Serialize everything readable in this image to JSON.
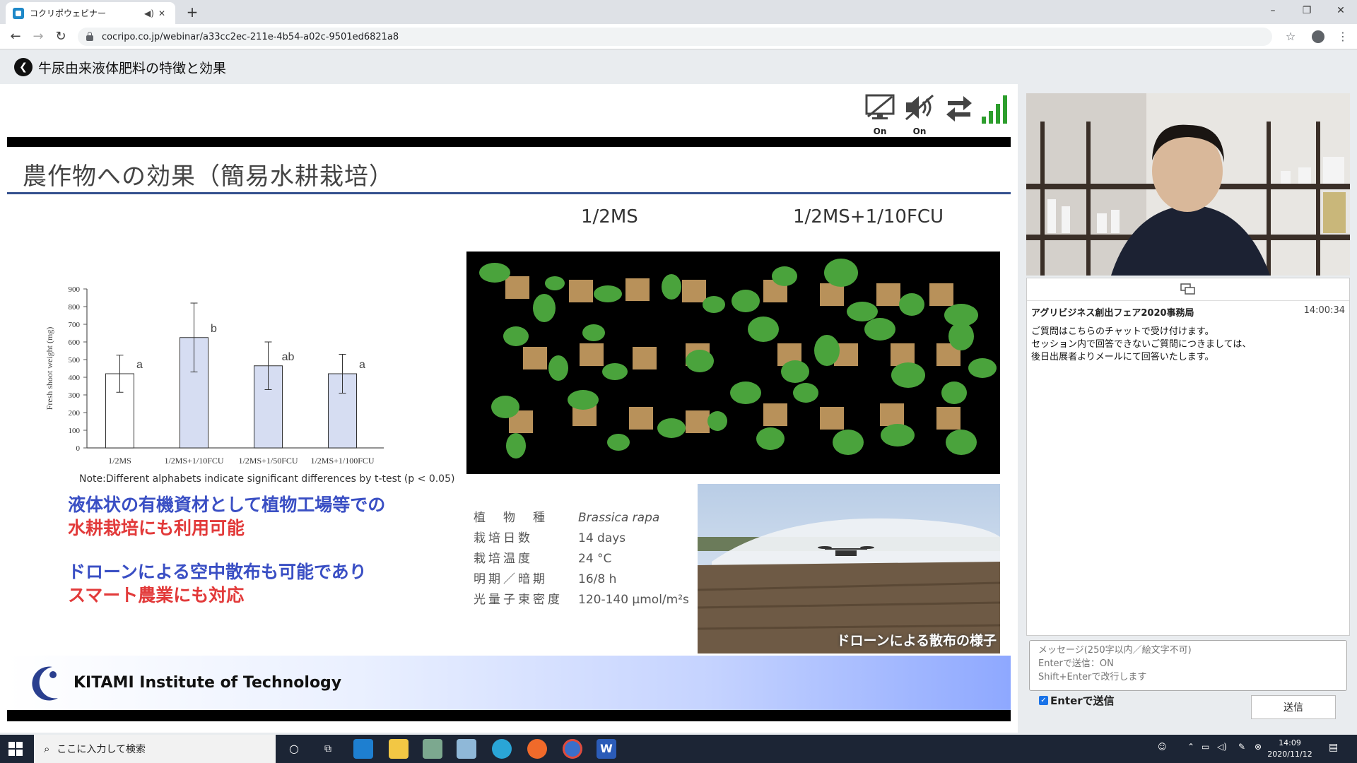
{
  "browser": {
    "tab_title": "コクリポウェビナー",
    "url": "cocripo.co.jp/webinar/a33cc2ec-211e-4b54-a02c-9501ed6821a8",
    "new_tab": "+",
    "minimize": "–",
    "restore": "❐",
    "close": "✕"
  },
  "page": {
    "title": "牛尿由来液体肥料の特徴と効果"
  },
  "controls": {
    "screen_label": "On",
    "sound_label": "On"
  },
  "slide": {
    "title": "農作物への効果（簡易水耕栽培）",
    "note": "Note:Different alphabets indicate significant differences by t-test (p < 0.05)",
    "message1_line1": "液体状の有機資材として植物工場等での",
    "message1_line2": "水耕栽培にも利用可能",
    "message2_line1": "ドローンによる空中散布も可能であり",
    "message2_line2": "スマート農業にも対応",
    "plant_label_left": "1/2MS",
    "plant_label_right": "1/2MS+1/10FCU",
    "specs": [
      {
        "key": "植　物　種",
        "value": "Brassica rapa"
      },
      {
        "key": "栽培日数",
        "value": "14 days"
      },
      {
        "key": "栽培温度",
        "value": "24 °C"
      },
      {
        "key": "明期／暗期",
        "value": "16/8 h"
      },
      {
        "key": "光量子束密度",
        "value": "120-140 µmol/m²s"
      }
    ],
    "drone_caption": "ドローンによる散布の様子",
    "institute": "KITAMI Institute of Technology"
  },
  "chart_data": {
    "type": "bar",
    "categories": [
      "1/2MS",
      "1/2MS+1/10FCU",
      "1/2MS+1/50FCU",
      "1/2MS+1/100FCU"
    ],
    "values": [
      420,
      625,
      465,
      420
    ],
    "errors": [
      105,
      195,
      135,
      110
    ],
    "letters": [
      "a",
      "b",
      "ab",
      "a"
    ],
    "colors": [
      "#ffffff",
      "#d6ddf2",
      "#d6ddf2",
      "#d6ddf2"
    ],
    "ylabel": "Fresh shoot weight (mg)",
    "xlabel": "",
    "ylim": [
      0,
      900
    ],
    "yticks": [
      0,
      100,
      200,
      300,
      400,
      500,
      600,
      700,
      800,
      900
    ],
    "grid": false
  },
  "chat": {
    "sender": "アグリビジネス創出フェア2020事務局",
    "time": "14:00:34",
    "line1": "ご質問はこちらのチャットで受け付けます。",
    "line2": "セッション内で回答できないご質問につきましては、",
    "line3": "後日出展者よりメールにて回答いたします。",
    "placeholder": "メッセージ(250字以内／絵文字不可)\nEnterで送信：ON\nShift+Enterで改行します",
    "enter_label": "Enterで送信",
    "send_label": "送信"
  },
  "taskbar": {
    "search_placeholder": "ここに入力して検索",
    "time": "14:09",
    "date": "2020/11/12"
  }
}
